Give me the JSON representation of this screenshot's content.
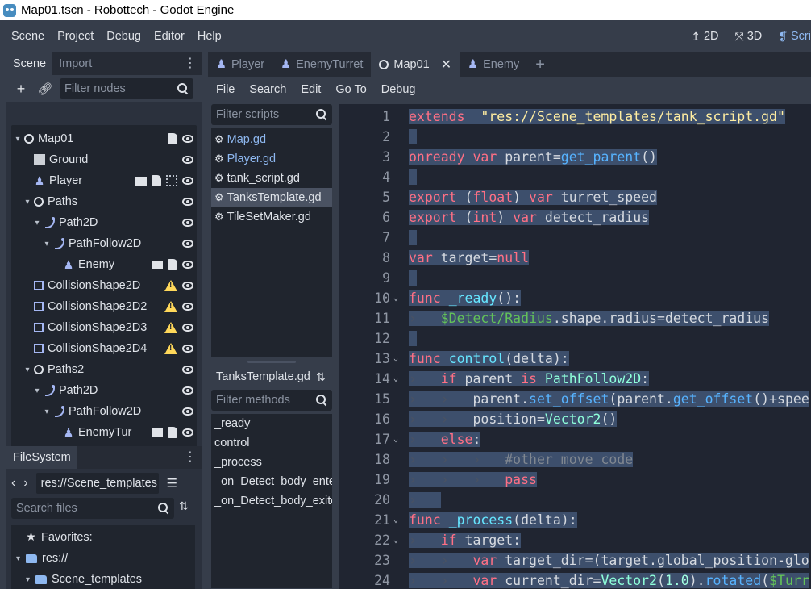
{
  "window": {
    "title": "Map01.tscn - Robottech - Godot Engine"
  },
  "menu": [
    "Scene",
    "Project",
    "Debug",
    "Editor",
    "Help"
  ],
  "workspaces": [
    {
      "label": "2D",
      "icon": "2d-icon"
    },
    {
      "label": "3D",
      "icon": "3d-icon"
    },
    {
      "label": "Scri",
      "icon": "script-icon"
    }
  ],
  "scene_dock": {
    "tabs": [
      "Scene",
      "Import"
    ],
    "filter_placeholder": "Filter nodes",
    "nodes": [
      {
        "label": "Map01",
        "icon": "node2d-icon",
        "depth": 0,
        "arrow": "▾",
        "icons": [
          "script",
          "eye"
        ]
      },
      {
        "label": "Ground",
        "icon": "tilemap-icon",
        "depth": 1,
        "arrow": "",
        "icons": [
          "eye"
        ]
      },
      {
        "label": "Player",
        "icon": "kinematic-icon",
        "depth": 1,
        "arrow": "",
        "icons": [
          "scene",
          "script",
          "group",
          "eye"
        ]
      },
      {
        "label": "Paths",
        "icon": "node2d-icon",
        "depth": 1,
        "arrow": "▾",
        "icons": [
          "eye"
        ]
      },
      {
        "label": "Path2D",
        "icon": "path-icon",
        "depth": 2,
        "arrow": "▾",
        "icons": [
          "eye"
        ]
      },
      {
        "label": "PathFollow2D",
        "icon": "path-icon",
        "depth": 3,
        "arrow": "▾",
        "icons": [
          "eye"
        ]
      },
      {
        "label": "Enemy",
        "icon": "kinematic-icon",
        "depth": 4,
        "arrow": "",
        "icons": [
          "scene",
          "script",
          "eye"
        ]
      },
      {
        "label": "CollisionShape2D",
        "icon": "collision-icon",
        "depth": 1,
        "arrow": "",
        "icons": [
          "warning",
          "eye"
        ]
      },
      {
        "label": "CollisionShape2D2",
        "icon": "collision-icon",
        "depth": 1,
        "arrow": "",
        "icons": [
          "warning",
          "eye"
        ]
      },
      {
        "label": "CollisionShape2D3",
        "icon": "collision-icon",
        "depth": 1,
        "arrow": "",
        "icons": [
          "warning",
          "eye"
        ]
      },
      {
        "label": "CollisionShape2D4",
        "icon": "collision-icon",
        "depth": 1,
        "arrow": "",
        "icons": [
          "warning",
          "eye"
        ]
      },
      {
        "label": "Paths2",
        "icon": "node2d-icon",
        "depth": 1,
        "arrow": "▾",
        "icons": [
          "eye"
        ]
      },
      {
        "label": "Path2D",
        "icon": "path-icon",
        "depth": 2,
        "arrow": "▾",
        "icons": [
          "eye"
        ]
      },
      {
        "label": "PathFollow2D",
        "icon": "path-icon",
        "depth": 3,
        "arrow": "▾",
        "icons": [
          "eye"
        ]
      },
      {
        "label": "EnemyTur",
        "icon": "kinematic-icon",
        "depth": 4,
        "arrow": "",
        "icons": [
          "scene",
          "script",
          "eye"
        ]
      }
    ]
  },
  "filesystem_dock": {
    "title": "FileSystem",
    "path": "res://Scene_templates",
    "search_placeholder": "Search files",
    "items": [
      {
        "label": "Favorites:",
        "icon": "star-icon",
        "depth": 0,
        "arrow": ""
      },
      {
        "label": "res://",
        "icon": "folder-icon",
        "depth": 0,
        "arrow": "▾"
      },
      {
        "label": "Scene_templates",
        "icon": "folder-icon",
        "depth": 1,
        "arrow": "▾"
      }
    ]
  },
  "editor_tabs": [
    {
      "label": "Player",
      "icon": "kinematic-icon",
      "active": false
    },
    {
      "label": "EnemyTurret",
      "icon": "kinematic-icon",
      "active": false
    },
    {
      "label": "Map01",
      "icon": "node2d-icon",
      "active": true
    },
    {
      "label": "Enemy",
      "icon": "kinematic-icon",
      "active": false
    }
  ],
  "script_menu": [
    "File",
    "Search",
    "Edit",
    "Go To",
    "Debug"
  ],
  "scripts_panel": {
    "filter_placeholder": "Filter scripts",
    "scripts": [
      {
        "label": "Map.gd",
        "blue": true,
        "selected": false
      },
      {
        "label": "Player.gd",
        "blue": true,
        "selected": false
      },
      {
        "label": "tank_script.gd",
        "blue": false,
        "selected": false
      },
      {
        "label": "TanksTemplate.gd",
        "blue": false,
        "selected": true
      },
      {
        "label": "TileSetMaker.gd",
        "blue": false,
        "selected": false
      }
    ],
    "current_file": "TanksTemplate.gd",
    "methods_placeholder": "Filter methods",
    "methods": [
      "_ready",
      "control",
      "_process",
      "_on_Detect_body_entered",
      "_on_Detect_body_exited"
    ]
  },
  "code": {
    "lines": [
      {
        "n": "1",
        "fold": "",
        "tabs": 0,
        "tokens": [
          [
            "kw",
            "extends"
          ],
          [
            "",
            "  "
          ],
          [
            "str",
            "\"res://Scene_templates/tank_script.gd\""
          ]
        ]
      },
      {
        "n": "2",
        "fold": "",
        "tabs": 0,
        "tokens": []
      },
      {
        "n": "3",
        "fold": "",
        "tabs": 0,
        "tokens": [
          [
            "kw",
            "onready"
          ],
          [
            "",
            " "
          ],
          [
            "kw",
            "var"
          ],
          [
            "",
            " parent="
          ],
          [
            "fn",
            "get_parent"
          ],
          [
            "",
            "()"
          ]
        ]
      },
      {
        "n": "4",
        "fold": "",
        "tabs": 0,
        "tokens": []
      },
      {
        "n": "5",
        "fold": "",
        "tabs": 0,
        "tokens": [
          [
            "kw",
            "export"
          ],
          [
            "",
            " ("
          ],
          [
            "kw",
            "float"
          ],
          [
            "",
            ") "
          ],
          [
            "kw",
            "var"
          ],
          [
            "",
            " turret_speed"
          ]
        ]
      },
      {
        "n": "6",
        "fold": "",
        "tabs": 0,
        "tokens": [
          [
            "kw",
            "export"
          ],
          [
            "",
            " ("
          ],
          [
            "kw",
            "int"
          ],
          [
            "",
            ") "
          ],
          [
            "kw",
            "var"
          ],
          [
            "",
            " detect_radius"
          ]
        ]
      },
      {
        "n": "7",
        "fold": "",
        "tabs": 0,
        "tokens": []
      },
      {
        "n": "8",
        "fold": "",
        "tabs": 0,
        "tokens": [
          [
            "kw",
            "var"
          ],
          [
            "",
            " target="
          ],
          [
            "kw",
            "null"
          ]
        ]
      },
      {
        "n": "9",
        "fold": "",
        "tabs": 0,
        "tokens": []
      },
      {
        "n": "10",
        "fold": "⌄",
        "tabs": 0,
        "tokens": [
          [
            "kw",
            "func"
          ],
          [
            "",
            " "
          ],
          [
            "fnc",
            "_ready"
          ],
          [
            "",
            "():"
          ]
        ]
      },
      {
        "n": "11",
        "fold": "",
        "tabs": 1,
        "tokens": [
          [
            "nd",
            "$Detect/Radius"
          ],
          [
            "",
            ".shape.radius=detect_radius"
          ]
        ]
      },
      {
        "n": "12",
        "fold": "",
        "tabs": 0,
        "tokens": []
      },
      {
        "n": "13",
        "fold": "⌄",
        "tabs": 0,
        "tokens": [
          [
            "kw",
            "func"
          ],
          [
            "",
            " "
          ],
          [
            "fnc",
            "control"
          ],
          [
            "",
            "(delta):"
          ]
        ]
      },
      {
        "n": "14",
        "fold": "⌄",
        "tabs": 1,
        "tokens": [
          [
            "kw",
            "if"
          ],
          [
            "",
            " parent "
          ],
          [
            "kw",
            "is"
          ],
          [
            "",
            " "
          ],
          [
            "ty",
            "PathFollow2D"
          ],
          [
            "",
            ":"
          ]
        ]
      },
      {
        "n": "15",
        "fold": "",
        "tabs": 2,
        "tokens": [
          [
            "",
            "parent."
          ],
          [
            "fn",
            "set_offset"
          ],
          [
            "",
            "(parent."
          ],
          [
            "fn",
            "get_offset"
          ],
          [
            "",
            "()+spee"
          ]
        ]
      },
      {
        "n": "16",
        "fold": "",
        "tabs": 2,
        "tokens": [
          [
            "",
            "position="
          ],
          [
            "ty",
            "Vector2"
          ],
          [
            "",
            "()"
          ]
        ]
      },
      {
        "n": "17",
        "fold": "⌄",
        "tabs": 1,
        "tokens": [
          [
            "kw",
            "else"
          ],
          [
            "",
            ":"
          ]
        ]
      },
      {
        "n": "18",
        "fold": "",
        "tabs": 3,
        "tokens": [
          [
            "cm",
            "#other move code"
          ]
        ]
      },
      {
        "n": "19",
        "fold": "",
        "tabs": 3,
        "tokens": [
          [
            "kw",
            "pass"
          ]
        ]
      },
      {
        "n": "20",
        "fold": "",
        "tabs": 1,
        "tokens": []
      },
      {
        "n": "21",
        "fold": "⌄",
        "tabs": 0,
        "tokens": [
          [
            "kw",
            "func"
          ],
          [
            "",
            " "
          ],
          [
            "fnc",
            "_process"
          ],
          [
            "",
            "(delta):"
          ]
        ]
      },
      {
        "n": "22",
        "fold": "⌄",
        "tabs": 1,
        "tokens": [
          [
            "kw",
            "if"
          ],
          [
            "",
            " target:"
          ]
        ]
      },
      {
        "n": "23",
        "fold": "",
        "tabs": 2,
        "tokens": [
          [
            "kw",
            "var"
          ],
          [
            "",
            " target_dir=(target.global_position-glo"
          ]
        ]
      },
      {
        "n": "24",
        "fold": "",
        "tabs": 2,
        "tokens": [
          [
            "kw",
            "var"
          ],
          [
            "",
            " current_dir="
          ],
          [
            "ty",
            "Vector2"
          ],
          [
            "",
            "("
          ],
          [
            "nm",
            "1.0"
          ],
          [
            "",
            ")."
          ],
          [
            "fn",
            "rotated"
          ],
          [
            "",
            "("
          ],
          [
            "nd",
            "$Turr"
          ]
        ]
      }
    ]
  }
}
